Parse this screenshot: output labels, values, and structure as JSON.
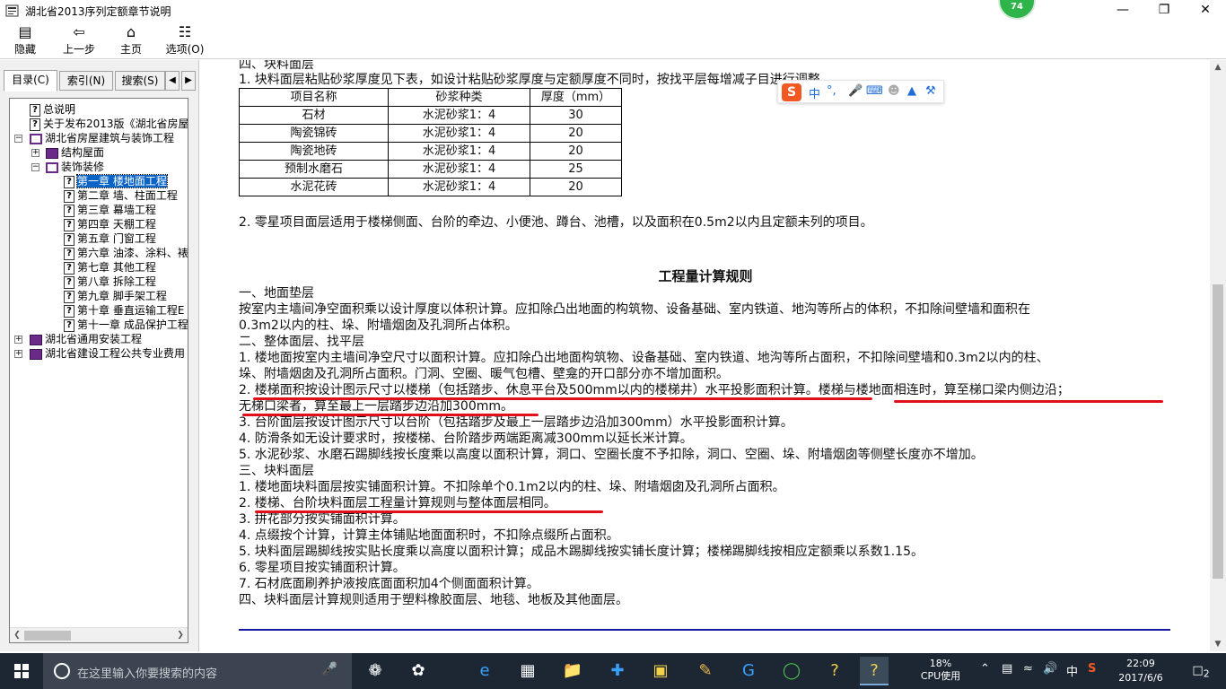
{
  "window": {
    "title": "湖北省2013序列定额章节说明",
    "badge": "74"
  },
  "toolbar": {
    "buttons": [
      {
        "label": "隐藏",
        "icon": "hide-icon"
      },
      {
        "label": "上一步",
        "icon": "back-arrow-icon"
      },
      {
        "label": "主页",
        "icon": "home-icon"
      },
      {
        "label": "选项(O)",
        "icon": "options-icon"
      }
    ]
  },
  "tabs": [
    "目录(C)",
    "索引(N)",
    "搜索(S)"
  ],
  "tree": [
    {
      "label": "总说明",
      "type": "topic"
    },
    {
      "label": "关于发布2013版《湖北省房屋",
      "type": "topic"
    },
    {
      "label": "湖北省房屋建筑与装饰工程",
      "type": "book-open"
    },
    {
      "label": "结构屋面",
      "type": "book"
    },
    {
      "label": "装饰装修",
      "type": "book-open"
    },
    {
      "label": "第一章 楼地面工程",
      "type": "topic",
      "selected": true
    },
    {
      "label": "第二章 墙、柱面工程",
      "type": "topic"
    },
    {
      "label": "第三章 幕墙工程",
      "type": "topic"
    },
    {
      "label": "第四章 天棚工程",
      "type": "topic"
    },
    {
      "label": "第五章 门窗工程",
      "type": "topic"
    },
    {
      "label": "第六章 油漆、涂料、裱",
      "type": "topic"
    },
    {
      "label": "第七章 其他工程",
      "type": "topic"
    },
    {
      "label": "第八章 拆除工程",
      "type": "topic"
    },
    {
      "label": "第九章 脚手架工程",
      "type": "topic"
    },
    {
      "label": "第十章 垂直运输工程E",
      "type": "topic"
    },
    {
      "label": "第十一章 成品保护工程",
      "type": "topic"
    },
    {
      "label": "湖北省通用安装工程",
      "type": "book"
    },
    {
      "label": "湖北省建设工程公共专业费用",
      "type": "book"
    }
  ],
  "doc": {
    "top_heading": "四、块料面层",
    "intro": "1. 块料面层粘贴砂浆厚度见下表，如设计粘贴砂浆厚度与定额厚度不同时，按找平层每增减子目进行调整。",
    "table_header": [
      "项目名称",
      "砂浆种类",
      "厚度（mm）"
    ],
    "table_rows": [
      [
        "石材",
        "水泥砂浆1：4",
        "30"
      ],
      [
        "陶瓷锦砖",
        "水泥砂浆1：4",
        "20"
      ],
      [
        "陶瓷地砖",
        "水泥砂浆1：4",
        "20"
      ],
      [
        "预制水磨石",
        "水泥砂浆1：4",
        "25"
      ],
      [
        "水泥花砖",
        "水泥砂浆1：4",
        "20"
      ]
    ],
    "note2": "2. 零星项目面层适用于楼梯侧面、台阶的牵边、小便池、蹲台、池槽，以及面积在0.5m2以内且定额未列的项目。",
    "rules_title": "工程量计算规则",
    "lines": [
      "一、地面垫层",
      "按室内主墙间净空面积乘以设计厚度以体积计算。应扣除凸出地面的构筑物、设备基础、室内铁道、地沟等所占的体积，不扣除间壁墙和面积在",
      "0.3m2以内的柱、垛、附墙烟囱及孔洞所占体积。",
      "二、整体面层、找平层",
      "1. 楼地面按室内主墙间净空尺寸以面积计算。应扣除凸出地面构筑物、设备基础、室内铁道、地沟等所占面积，不扣除间壁墙和0.3m2以内的柱、",
      "垛、附墙烟囱及孔洞所占面积。门洞、空圈、暖气包槽、壁龛的开口部分亦不增加面积。",
      "2. 楼梯面积按设计图示尺寸以楼梯（包括踏步、休息平台及500mm以内的楼梯井）水平投影面积计算。楼梯与楼地面相连时，算至梯口梁内侧边沿；",
      "无梯口梁者，算至最上一层踏步边沿加300mm。",
      "3. 台阶面层按设计图示尺寸以台阶（包括踏步及最上一层踏步边沿加300mm）水平投影面积计算。",
      "4. 防滑条如无设计要求时，按楼梯、台阶踏步两端距离减300mm以延长米计算。",
      "5. 水泥砂浆、水磨石踢脚线按长度乘以高度以面积计算，洞口、空圈长度不予扣除，洞口、空圈、垛、附墙烟囱等侧壁长度亦不增加。",
      "三、块料面层",
      "1. 楼地面块料面层按实铺面积计算。不扣除单个0.1m2以内的柱、垛、附墙烟囱及孔洞所占面积。",
      "2. 楼梯、台阶块料面层工程量计算规则与整体面层相同。",
      "3. 拼花部分按实铺面积计算。",
      "4. 点缀按个计算，计算主体铺贴地面面积时，不扣除点缀所占面积。",
      "5. 块料面层踢脚线按实贴长度乘以高度以面积计算；成品木踢脚线按实铺长度计算；楼梯踢脚线按相应定额乘以系数1.15。",
      "6. 零星项目按实铺面积计算。",
      "7. 石材底面刷养护液按底面面积加4个侧面面积计算。",
      "四、块料面层计算规则适用于塑料橡胶面层、地毯、地板及其他面层。"
    ]
  },
  "ime": {
    "label": "中",
    "punct": "°,"
  },
  "taskbar": {
    "search_placeholder": "在这里输入你要搜索的内容",
    "cpu_percent": "18%",
    "cpu_label": "CPU使用",
    "ime_lang": "中",
    "time": "22:09",
    "date": "2017/6/6",
    "notifications": "2"
  },
  "colors": {
    "accent_red": "#e0101a",
    "selection_blue": "#0a64c8",
    "taskbar": "#1c2733",
    "rule_blue": "#1818a0"
  }
}
